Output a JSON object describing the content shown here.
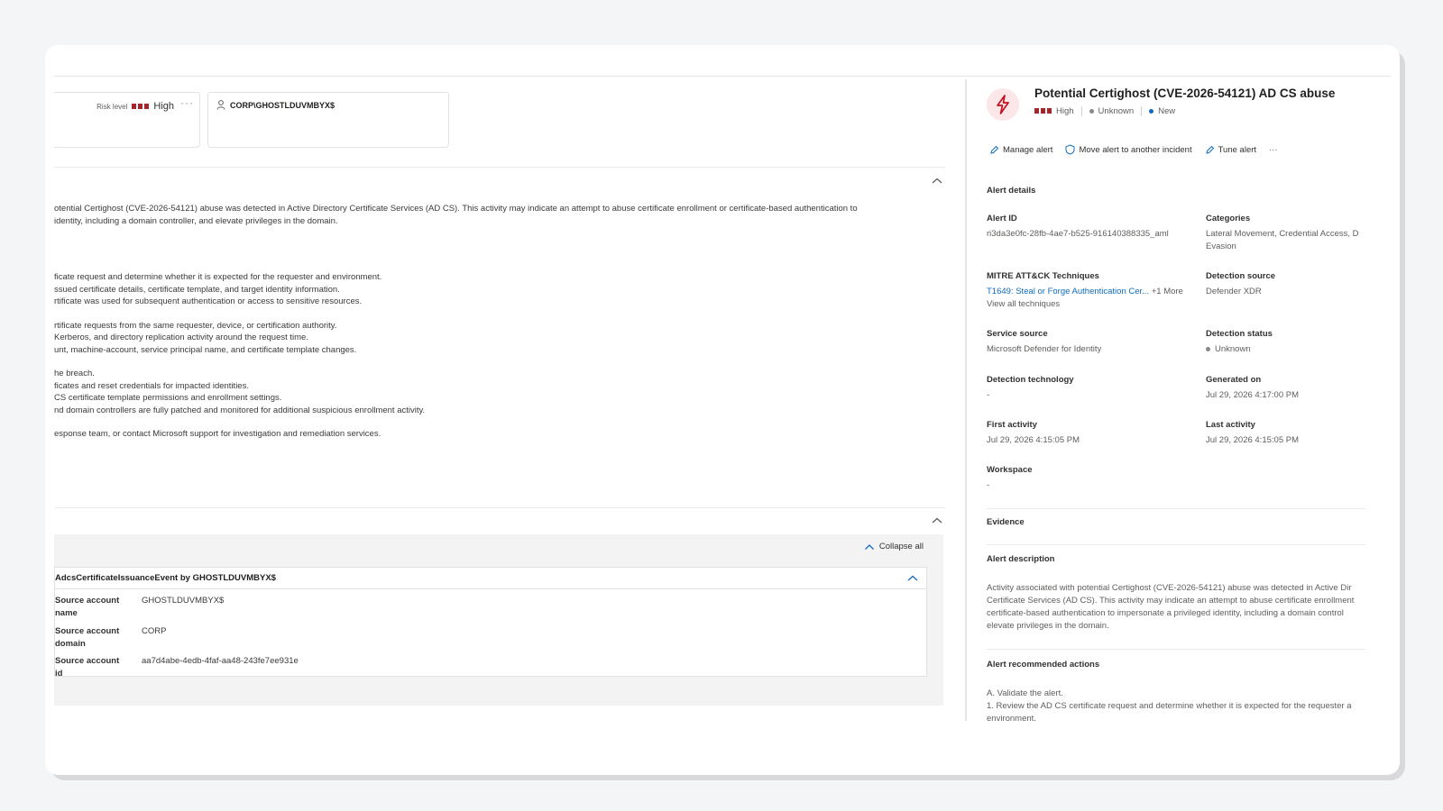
{
  "summary_cards": {
    "risk_label": "Risk level",
    "risk_value": "High",
    "entity_name": "CORP\\GHOSTLDUVMBYX$"
  },
  "left_description": {
    "line1": "otential Certighost (CVE-2026-54121) abuse was detected in Active Directory Certificate Services (AD CS). This activity may indicate an attempt to abuse certificate enrollment or certificate-based authentication to",
    "line2": "identity, including a domain controller, and elevate privileges in the domain."
  },
  "left_actions": [
    [
      "ficate request and determine whether it is expected for the requester and environment.",
      "ssued certificate details, certificate template, and target identity information.",
      "rtificate was used for subsequent authentication or access to sensitive resources."
    ],
    [
      "rtificate requests from the same requester, device, or certification authority.",
      " Kerberos, and directory replication activity around the request time.",
      "unt, machine-account, service principal name, and certificate template changes."
    ],
    [
      "he breach.",
      "ficates and reset credentials for impacted identities.",
      "CS certificate template permissions and enrollment settings.",
      "nd domain controllers are fully patched and monitored for additional suspicious enrollment activity."
    ],
    [
      "esponse team, or contact Microsoft support for investigation and remediation services."
    ]
  ],
  "evidence_panel": {
    "collapse_all": "Collapse all",
    "event_title": "AdcsCertificateIssuanceEvent by GHOSTLDUVMBYX$",
    "rows": [
      {
        "key": "Source account name",
        "value": "GHOSTLDUVMBYX$"
      },
      {
        "key": "Source account domain",
        "value": "CORP"
      },
      {
        "key": "Source account id",
        "value": "aa7d4abe-4edb-4faf-aa48-243fe7ee931e"
      }
    ]
  },
  "alert": {
    "title": "Potential Certighost (CVE-2026-54121) AD CS abuse",
    "severity": "High",
    "status_detection": "Unknown",
    "status": "New",
    "toolbar": {
      "manage": "Manage alert",
      "move": "Move alert to another incident",
      "tune": "Tune alert",
      "more": "···"
    },
    "details_title": "Alert details",
    "fields": {
      "alert_id_label": "Alert ID",
      "alert_id": "ri3da3e0fc-28fb-4ae7-b525-916140388335_aml",
      "categories_label": "Categories",
      "categories_line1": "Lateral Movement, Credential Access, D",
      "categories_line2": "Evasion",
      "mitre_label": "MITRE ATT&CK Techniques",
      "mitre_value": "T1649: Steal or Forge Authentication Cer...",
      "mitre_more": "+1 More",
      "view_all": "View all techniques",
      "detection_source_label": "Detection source",
      "detection_source": "Defender XDR",
      "service_source_label": "Service source",
      "service_source": "Microsoft Defender for Identity",
      "detection_status_label": "Detection status",
      "detection_status": "Unknown",
      "detection_tech_label": "Detection technology",
      "detection_tech": "-",
      "generated_label": "Generated on",
      "generated": "Jul 29, 2026 4:17:00 PM",
      "first_activity_label": "First activity",
      "first_activity": "Jul 29, 2026 4:15:05 PM",
      "last_activity_label": "Last activity",
      "last_activity": "Jul 29, 2026 4:15:05 PM",
      "workspace_label": "Workspace",
      "workspace": "-"
    },
    "evidence_title": "Evidence",
    "description_title": "Alert description",
    "description_lines": [
      "Activity associated with potential Certighost (CVE-2026-54121) abuse was detected in Active Dir",
      "Certificate Services (AD CS). This activity may indicate an attempt to abuse certificate enrollment",
      "certificate-based authentication to impersonate a privileged identity, including a domain control",
      "elevate privileges in the domain."
    ],
    "recommended_title": "Alert recommended actions",
    "recommended_lines": [
      "A. Validate the alert.",
      "1. Review the AD CS certificate request and determine whether it is expected for the requester a",
      "environment."
    ]
  },
  "colors": {
    "severity_high": "#a4262c",
    "status_new": "#0f6cbd",
    "status_unknown": "#8a8886",
    "link": "#0f6cbd"
  }
}
